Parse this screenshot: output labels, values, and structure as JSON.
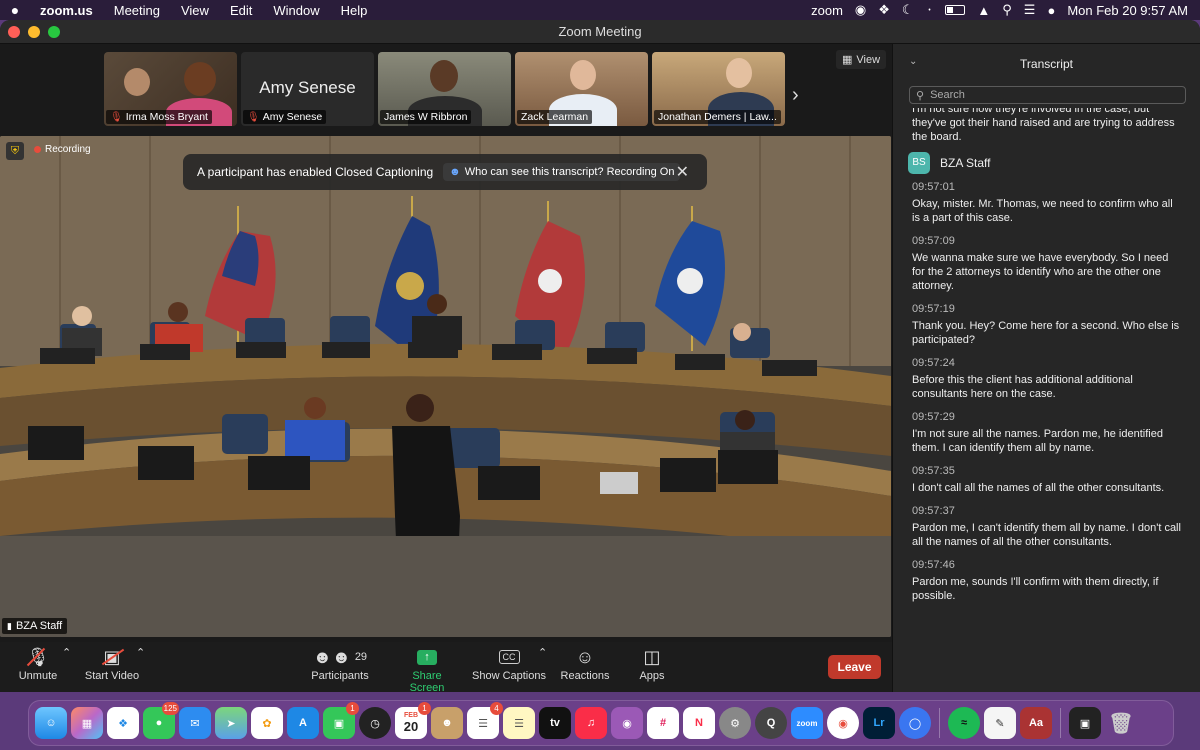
{
  "menubar": {
    "app": "zoom.us",
    "items": [
      "Meeting",
      "View",
      "Edit",
      "Window",
      "Help"
    ],
    "right": {
      "zoom_label": "zoom",
      "datetime": "Mon Feb 20  9:57 AM"
    }
  },
  "window": {
    "title": "Zoom Meeting"
  },
  "gallery": {
    "view_label": "View",
    "tiles": [
      {
        "name": "Irma Moss Bryant",
        "muted": true
      },
      {
        "name": "Amy Senese",
        "display": "Amy Senese",
        "muted": true
      },
      {
        "name": "James W Ribbron",
        "muted": false
      },
      {
        "name": "Zack Learman",
        "muted": false
      },
      {
        "name": "Jonathan Demers | Law...",
        "muted": false
      }
    ]
  },
  "video": {
    "recording_label": "Recording",
    "banner_text": "A participant has enabled Closed Captioning",
    "banner_link": "Who can see this transcript? Recording On",
    "speaker": "BZA Staff"
  },
  "toolbar": {
    "unmute": "Unmute",
    "start_video": "Start Video",
    "participants": "Participants",
    "participants_count": "29",
    "share_screen": "Share Screen",
    "show_captions": "Show Captions",
    "cc_icon": "CC",
    "reactions": "Reactions",
    "apps": "Apps",
    "leave": "Leave"
  },
  "transcript": {
    "title": "Transcript",
    "search_placeholder": "Search",
    "cut_text": "I'm not sure how they're involved in the case, but they've got their hand raised and are trying to address the board.",
    "speaker": "BZA Staff",
    "speaker_initials": "BS",
    "entries": [
      {
        "time": "09:57:01",
        "text": "Okay, mister. Mr. Thomas, we need to confirm who all is a part of this case."
      },
      {
        "time": "09:57:09",
        "text": "We wanna make sure we have everybody. So I need for the 2 attorneys to identify who are the other one attorney."
      },
      {
        "time": "09:57:19",
        "text": "Thank you. Hey? Come here for a second. Who else is participated?"
      },
      {
        "time": "09:57:24",
        "text": "Before this the client has additional additional consultants here on the case."
      },
      {
        "time": "09:57:29",
        "text": "I'm not sure all the names. Pardon me, he identified them. I can identify them all by name."
      },
      {
        "time": "09:57:35",
        "text": "I don't call all the names of all the other consultants."
      },
      {
        "time": "09:57:37",
        "text": "Pardon me, I can't identify them all by name. I don't call all the names of all the other consultants."
      },
      {
        "time": "09:57:46",
        "text": "Pardon me, sounds I'll confirm with them directly, if possible."
      }
    ]
  },
  "dock": {
    "messages_badge": "125",
    "facetime_badge": "1",
    "calendar_month": "FEB",
    "calendar_day": "20",
    "calendar_badge": "1",
    "reminders_badge": "4",
    "lightroom": "Lr",
    "dictionary": "Aa",
    "zoom": "zoom",
    "tv": "tv"
  }
}
